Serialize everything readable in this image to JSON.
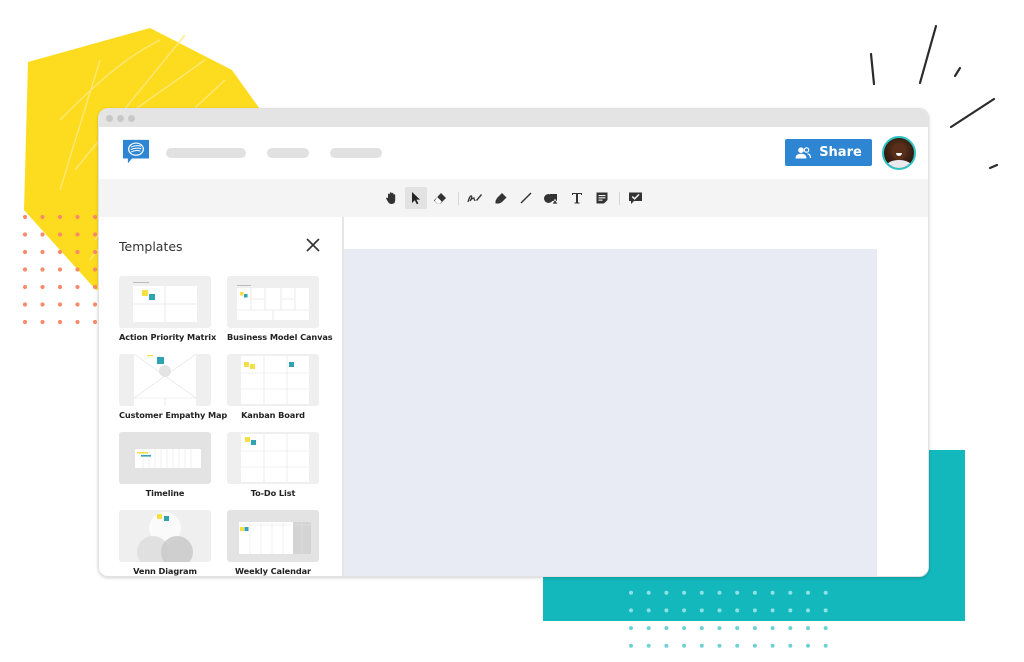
{
  "app": {
    "window_controls": [
      "close",
      "minimize",
      "maximize"
    ],
    "logo_icon": "chat-bubble-logo-icon"
  },
  "header": {
    "share_label": "Share",
    "share_icon": "people-icon",
    "avatar_alt": "user-avatar"
  },
  "toolbar": {
    "tools": [
      {
        "name": "hand-tool",
        "icon": "hand-icon",
        "active": false
      },
      {
        "name": "select-tool",
        "icon": "cursor-arrow-icon",
        "active": true
      },
      {
        "name": "eraser-tool",
        "icon": "eraser-icon",
        "active": false
      },
      {
        "name": "pen-tool",
        "icon": "pen-scribble-icon",
        "active": false
      },
      {
        "name": "highlighter-tool",
        "icon": "highlighter-icon",
        "active": false
      },
      {
        "name": "line-tool",
        "icon": "line-icon",
        "active": false
      },
      {
        "name": "shapes-tool",
        "icon": "shapes-icon",
        "active": false
      },
      {
        "name": "text-tool",
        "icon": "text-icon",
        "active": false
      },
      {
        "name": "sticky-note-tool",
        "icon": "sticky-note-icon",
        "active": false
      },
      {
        "name": "comment-tool",
        "icon": "comment-check-icon",
        "active": false
      }
    ]
  },
  "sidebar": {
    "title": "Templates",
    "close_icon": "close-icon",
    "templates": [
      {
        "label": "Action Priority Matrix"
      },
      {
        "label": "Business Model Canvas"
      },
      {
        "label": "Customer Empathy Map"
      },
      {
        "label": "Kanban Board"
      },
      {
        "label": "Timeline"
      },
      {
        "label": "To-Do List"
      },
      {
        "label": "Venn Diagram"
      },
      {
        "label": "Weekly Calendar"
      }
    ]
  },
  "colors": {
    "accent_blue": "#2e86d3",
    "teal": "#13b8bc",
    "yellow": "#fddc1f",
    "orange_dots": "#f98a6a",
    "canvas_bg": "#e8ebf3",
    "sticky_yellow": "#f6de45",
    "sticky_teal": "#2fa3b3"
  }
}
